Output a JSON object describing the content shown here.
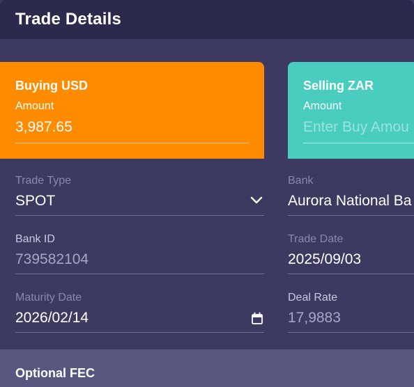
{
  "header": {
    "title": "Trade Details"
  },
  "buy_card": {
    "title": "Buying USD",
    "label": "Amount",
    "value": "3,987.65"
  },
  "sell_card": {
    "title": "Selling ZAR",
    "label": "Amount",
    "placeholder": "Enter Buy Amou"
  },
  "fields": {
    "trade_type": {
      "label": "Trade Type",
      "value": "SPOT",
      "icon": "chevron-down-icon"
    },
    "bank": {
      "label": "Bank",
      "value": "Aurora National Ba"
    },
    "bank_id": {
      "label": "Bank ID",
      "value": "739582104"
    },
    "trade_date": {
      "label": "Trade Date",
      "value": "2025/09/03"
    },
    "maturity_date": {
      "label": "Maturity Date",
      "value": "2026/02/14",
      "icon": "calendar-icon"
    },
    "deal_rate": {
      "label": "Deal Rate",
      "value": "17,9883"
    }
  },
  "footer": {
    "title": "Optional FEC"
  },
  "colors": {
    "buy": "#fe8b00",
    "sell": "#48cdbe",
    "background": "#3c3a61",
    "header": "#2c2a4c"
  }
}
